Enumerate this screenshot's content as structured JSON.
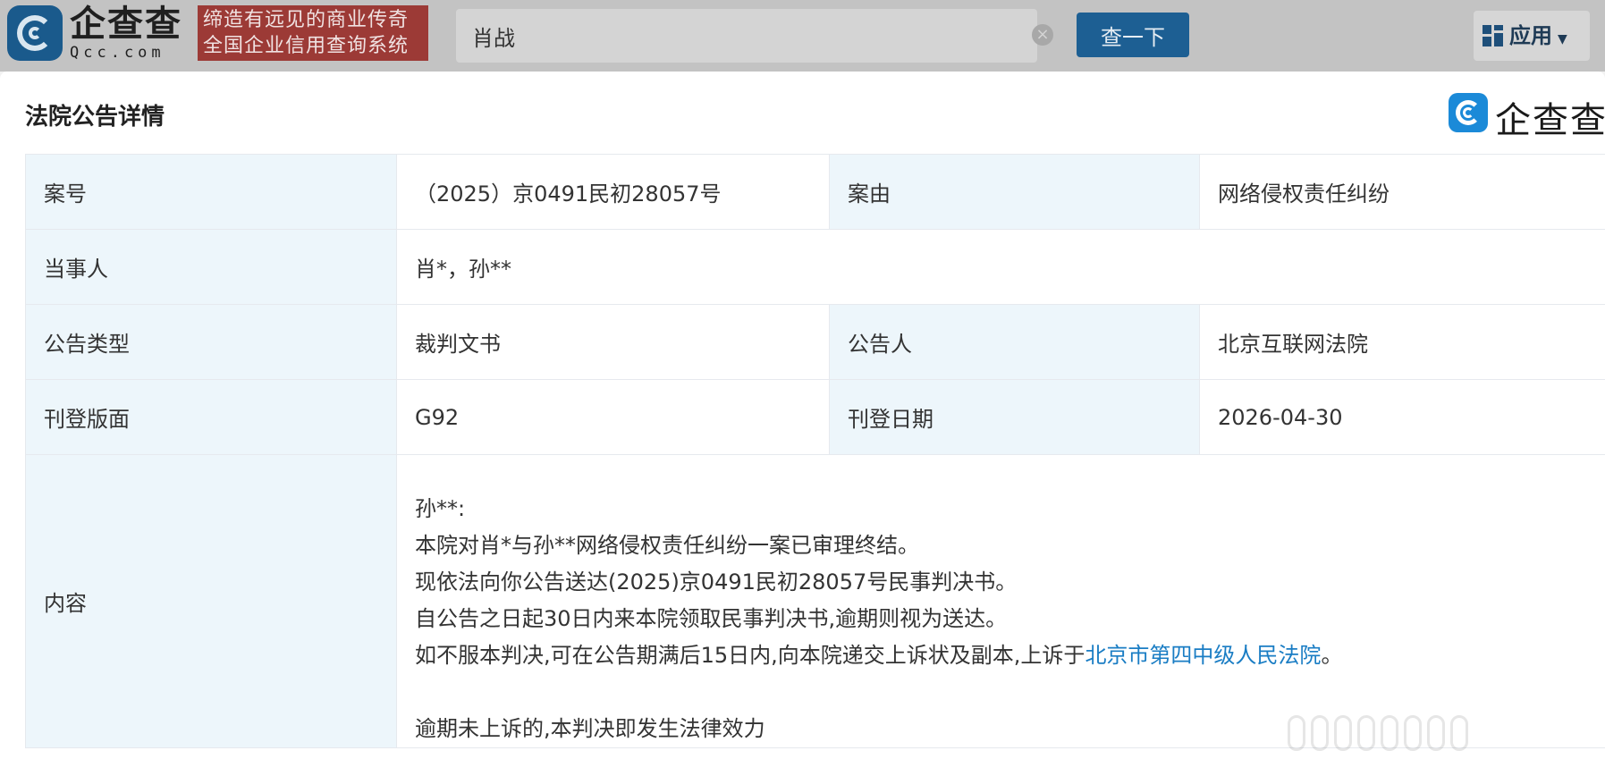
{
  "header": {
    "logo_cn": "企查查",
    "logo_en": "Qcc.com",
    "slogan_line1": "缔造有远见的商业传奇",
    "slogan_line2": "全国企业信用查询系统",
    "search_value": "肖战",
    "search_button": "查一下",
    "apps_label": "应用"
  },
  "modal": {
    "title": "法院公告详情",
    "brand": "企查查",
    "rows": {
      "case_no_label": "案号",
      "case_no_value": "（2025）京0491民初28057号",
      "cause_label": "案由",
      "cause_value": "网络侵权责任纠纷",
      "parties_label": "当事人",
      "parties_value": "肖*，孙**",
      "type_label": "公告类型",
      "type_value": "裁判文书",
      "announcer_label": "公告人",
      "announcer_value": "北京互联网法院",
      "page_label": "刊登版面",
      "page_value": "G92",
      "date_label": "刊登日期",
      "date_value": "2026-04-30",
      "content_label": "内容"
    },
    "content": {
      "line1": "孙**:",
      "line2": "本院对肖*与孙**网络侵权责任纠纷一案已审理终结。",
      "line3": "现依法向你公告送达(2025)京0491民初28057号民事判决书。",
      "line4": "自公告之日起30日内来本院领取民事判决书,逾期则视为送达。",
      "line5_prefix": "如不服本判决,可在公告期满后15日内,向本院递交上诉状及副本,上诉于",
      "line5_link": "北京市第四中级人民法院",
      "line5_suffix": "。",
      "line6": "逾期未上诉的,本判决即发生法律效力"
    }
  }
}
